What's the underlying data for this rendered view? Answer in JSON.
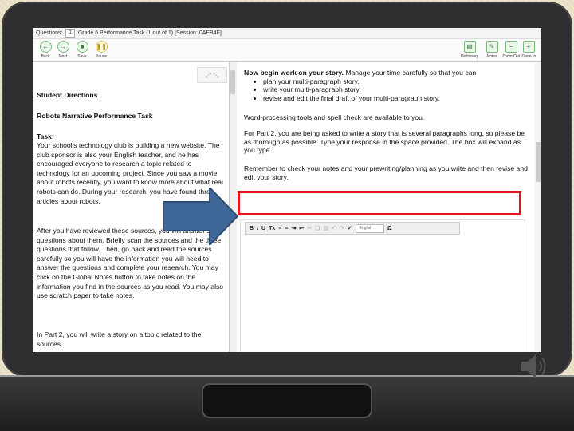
{
  "questions_bar": {
    "label": "Questions:",
    "selected": "1",
    "title": "Grade 6 Performance Task (1 out of 1)  [Session: 0AEB4F]"
  },
  "toolbar": {
    "back": "Back",
    "next": "Next",
    "save": "Save",
    "pause": "Pause",
    "dictionary": "Dictionary",
    "notes": "Notes",
    "zoom_out": "Zoom Out",
    "zoom_in": "Zoom In"
  },
  "left": {
    "heading1": "Student Directions",
    "heading2": "Robots Narrative Performance Task",
    "task_label": "Task:",
    "task_text": "Your school's technology club is building a new website. The club sponsor is also your English teacher, and he has encouraged everyone to research a topic related to technology for an upcoming project. Since you saw a movie about robots recently, you want to know more about what real robots can do. During your research, you have found three articles about robots.",
    "para2": "After you have reviewed these sources, you will answer some questions about them. Briefly scan the sources and the three questions that follow. Then, go back and read the sources carefully so you will have the information you will need to answer the questions and complete your research. You may click on the Global Notes button to take notes on the information you find in the sources as you read. You may also use scratch paper to take notes.",
    "para3": "In Part 2, you will write a story on a topic related to the sources."
  },
  "right": {
    "intro_bold": "Now begin work on your story.",
    "intro_rest": " Manage your time carefully so that you can",
    "bullets": [
      "plan your multi-paragraph story.",
      "write your multi-paragraph story.",
      "revise and edit the final draft of your multi-paragraph story."
    ],
    "p1": "Word-processing tools and spell check are available to you.",
    "p2": "For Part 2, you are being asked to write a story that is several paragraphs long, so please be as thorough as possible. Type your response in the space provided. The box will expand as you type.",
    "p3": "Remember to check your notes and your prewriting/planning as you write and then revise and edit your story."
  },
  "editor": {
    "bold": "B",
    "italic": "I",
    "underline": "U",
    "remove_format": "Tx",
    "language": "English",
    "special_char": "Ω"
  },
  "colors": {
    "highlight_box": "#e0141e",
    "arrow_fill": "#3f6797"
  }
}
